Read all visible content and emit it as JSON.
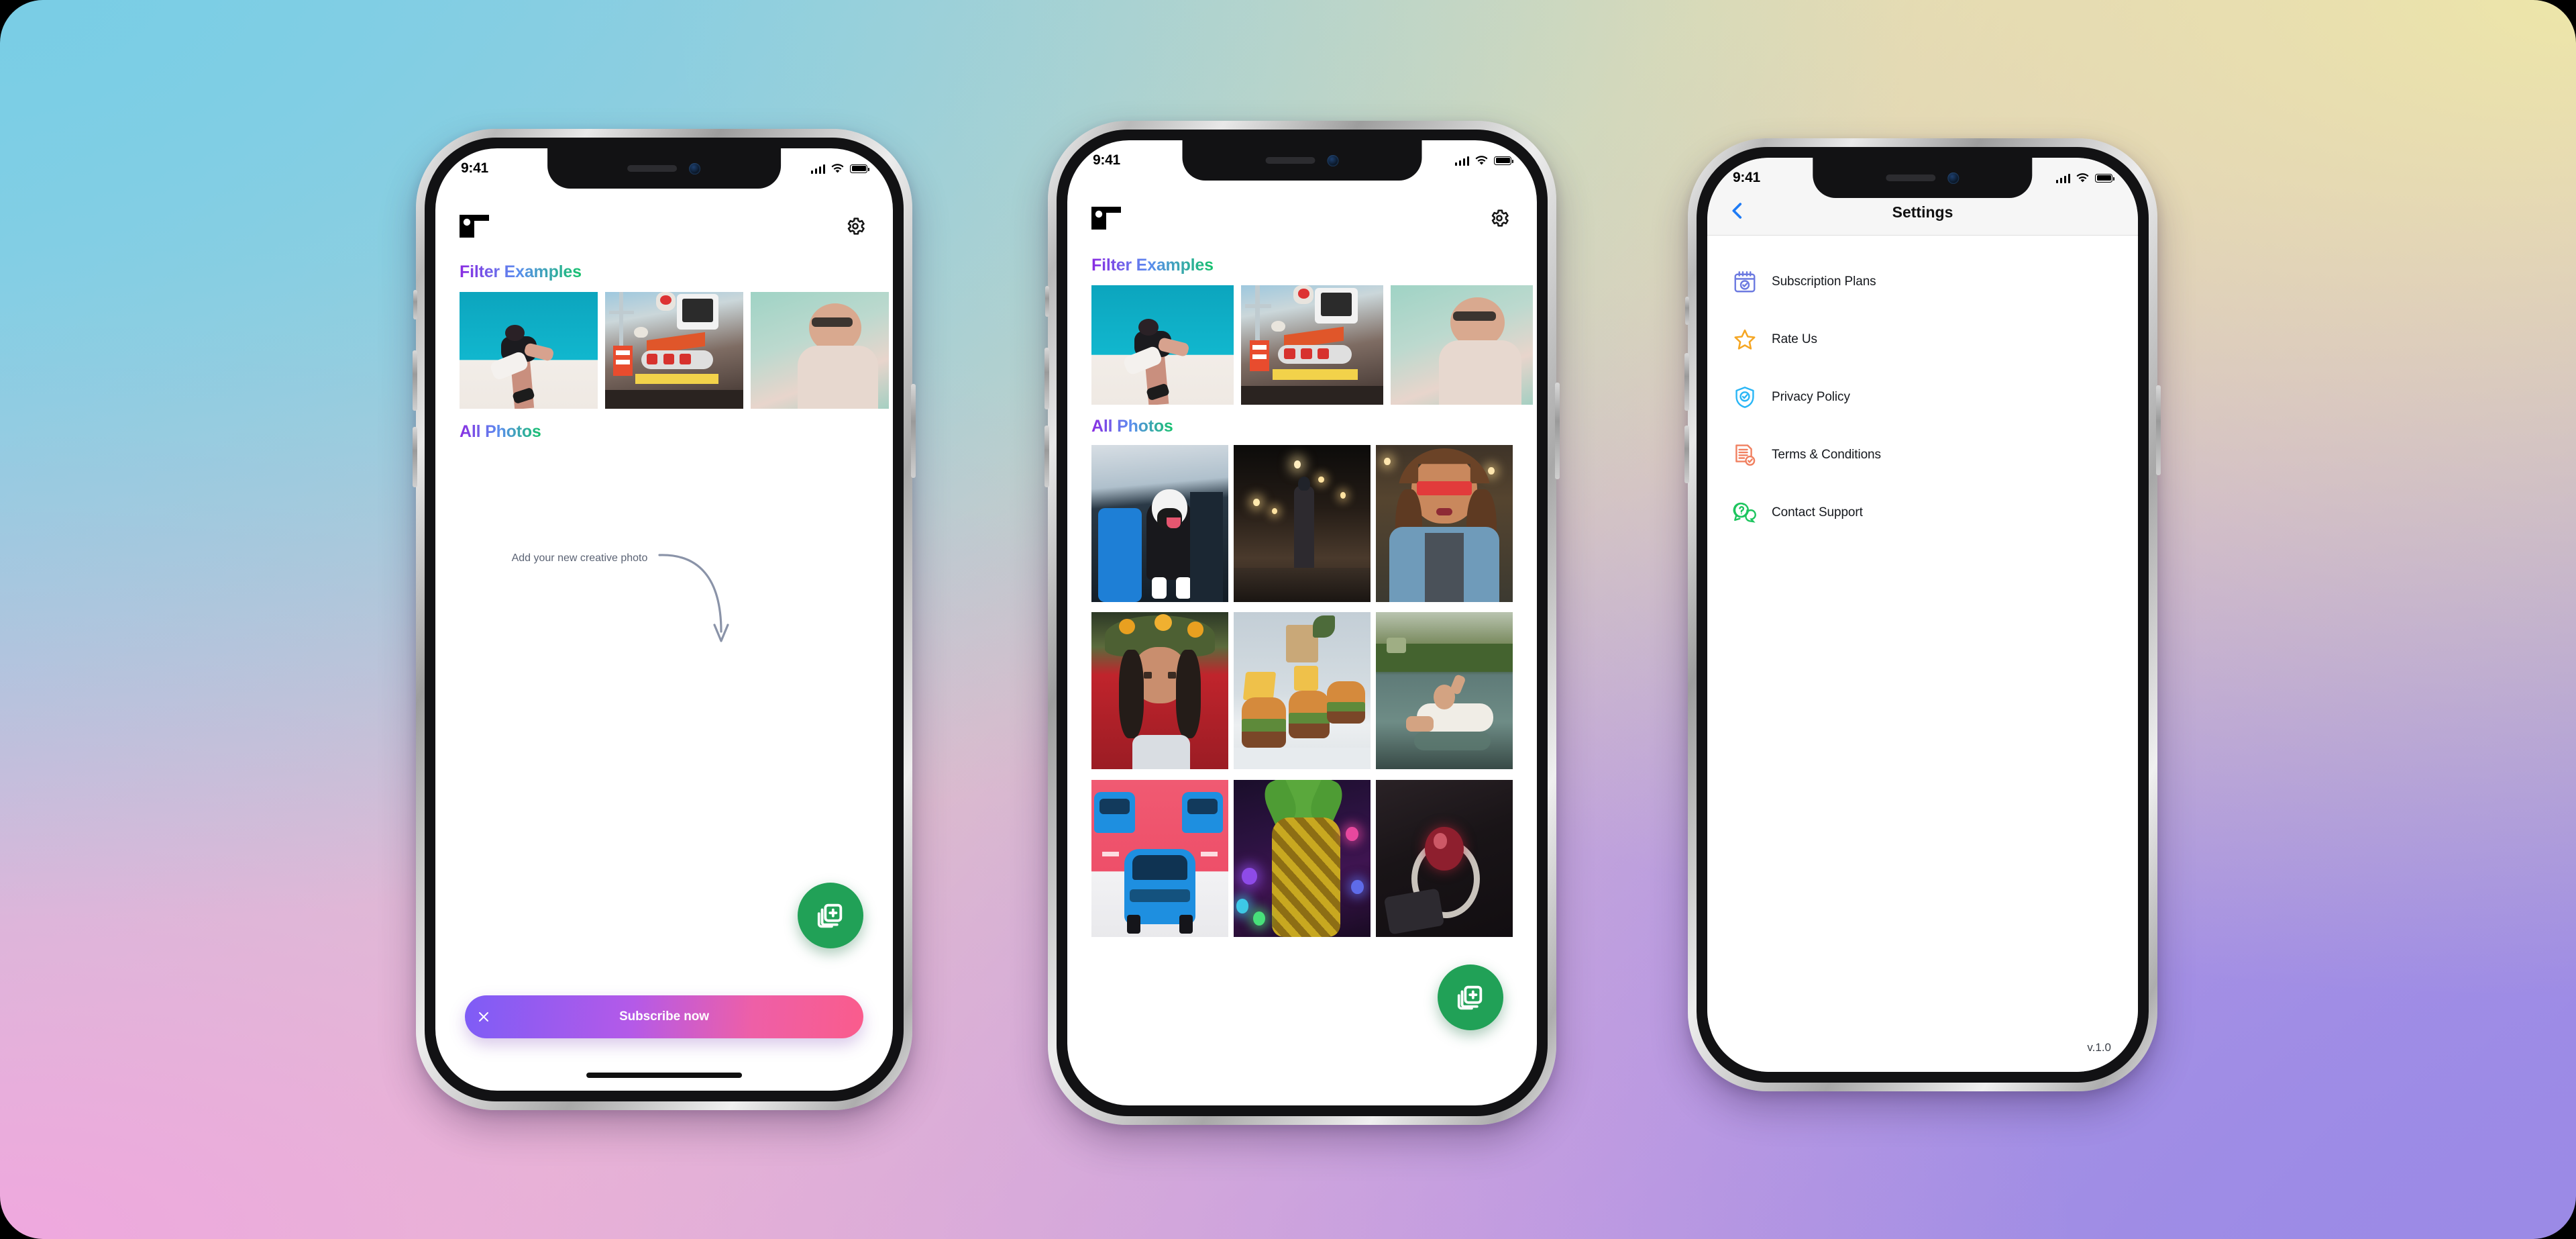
{
  "background": {
    "corner_top_left": "#79CDE5",
    "corner_top_right": "#EDE6A9",
    "corner_bottom_left": "#EFA8DE",
    "corner_bottom_right": "#9B8AE6"
  },
  "theme": {
    "accent_gradient_start": "#8A2BE2",
    "accent_gradient_mid": "#5B8DEF",
    "accent_gradient_end": "#15C26B",
    "fab_green": "#21A157",
    "subscribe_gradient_start": "#7E5CF6",
    "subscribe_gradient_end": "#FA5C8C",
    "nav_back_blue": "#1E7BF5"
  },
  "status_bar": {
    "time": "9:41",
    "cellular_icon": "signal-bars-icon",
    "wifi_icon": "wifi-icon",
    "battery_icon": "battery-icon"
  },
  "phones": [
    {
      "id": "phone-home-empty",
      "header": {
        "logo": "pf-logo",
        "logo_text": "PF",
        "settings_icon": "gear-icon"
      },
      "sections": [
        {
          "title": "Filter Examples"
        },
        {
          "title": "All Photos"
        }
      ],
      "filter_examples": [
        {
          "name": "woman-teal-sky-filter"
        },
        {
          "name": "neon-city-street-filter"
        },
        {
          "name": "mint-pool-portrait-filter"
        }
      ],
      "empty_state": {
        "hint": "Add your new creative photo",
        "arrow_icon": "curved-arrow-icon",
        "fab_icon": "add-photo-stack-icon"
      },
      "subscribe": {
        "label": "Subscribe now",
        "close_icon": "close-x-icon"
      },
      "home_indicator": "home-indicator"
    },
    {
      "id": "phone-home-gallery",
      "header": {
        "logo": "pf-logo",
        "logo_text": "PF",
        "settings_icon": "gear-icon"
      },
      "sections": [
        {
          "title": "Filter Examples"
        },
        {
          "title": "All Photos"
        }
      ],
      "filter_examples": [
        {
          "name": "woman-teal-sky-filter"
        },
        {
          "name": "neon-city-street-filter"
        },
        {
          "name": "mint-pool-portrait-filter"
        }
      ],
      "photos": [
        {
          "name": "dog-in-car"
        },
        {
          "name": "night-street-lights"
        },
        {
          "name": "woman-red-sunglasses"
        },
        {
          "name": "woman-flower-crown"
        },
        {
          "name": "burgers-and-fries"
        },
        {
          "name": "lake-float-sunset"
        },
        {
          "name": "blue-sports-cars"
        },
        {
          "name": "neon-pineapple"
        },
        {
          "name": "dark-ring-jewelry"
        }
      ],
      "fab_icon": "add-photo-stack-icon"
    },
    {
      "id": "phone-settings",
      "nav": {
        "back_icon": "chevron-left-icon",
        "title": "Settings"
      },
      "items": [
        {
          "label": "Subscription Plans",
          "icon": "calendar-check-icon",
          "color": "#6C7AE0"
        },
        {
          "label": "Rate Us",
          "icon": "star-outline-icon",
          "color": "#F5A623"
        },
        {
          "label": "Privacy Policy",
          "icon": "shield-check-icon",
          "color": "#29B6F6"
        },
        {
          "label": "Terms & Conditions",
          "icon": "document-check-icon",
          "color": "#F08060"
        },
        {
          "label": "Contact Support",
          "icon": "chat-question-icon",
          "color": "#1DC55E"
        }
      ],
      "version": "v.1.0"
    }
  ]
}
